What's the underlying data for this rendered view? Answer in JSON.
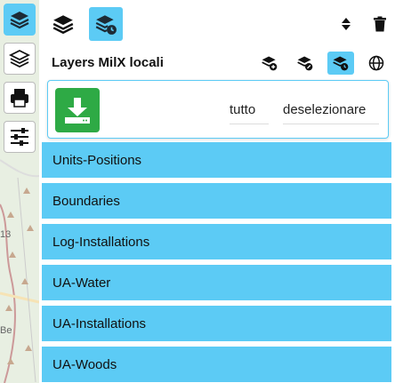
{
  "panel": {
    "title": "Layers MilX locali",
    "select_all_label": "tutto",
    "deselect_label": "deselezionare"
  },
  "layers": [
    {
      "label": "Units-Positions"
    },
    {
      "label": "Boundaries"
    },
    {
      "label": "Log-Installations"
    },
    {
      "label": "UA-Water"
    },
    {
      "label": "UA-Installations"
    },
    {
      "label": "UA-Woods"
    }
  ],
  "map": {
    "labels": [
      "13",
      "Be"
    ]
  },
  "colors": {
    "accent": "#5ccbf5",
    "download": "#2eaa45"
  }
}
